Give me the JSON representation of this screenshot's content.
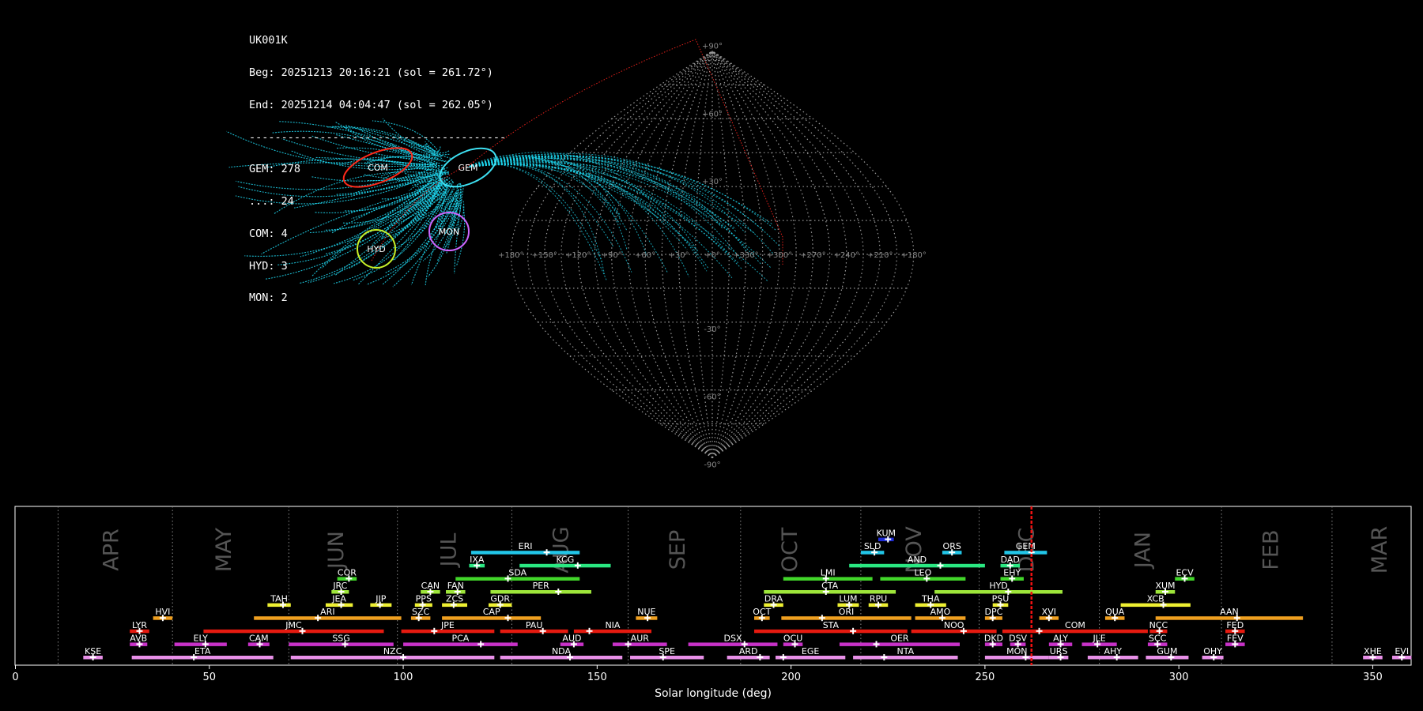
{
  "summary": {
    "station": "UK001K",
    "begin": "Beg: 20251213 20:16:21 (sol = 261.72°)",
    "end": "End: 20251214 04:04:47 (sol = 262.05°)",
    "separator": "----------------------------------------",
    "counts": [
      "GEM: 278",
      "...: 24",
      "COM: 4",
      "HYD: 3",
      "MON: 2"
    ]
  },
  "sky_map": {
    "projection": "sinusoidal",
    "lon_labels": [
      "+180°",
      "+150°",
      "+120°",
      "+90°",
      "+60°",
      "+30°",
      "+0°",
      "+330°",
      "+300°",
      "+270°",
      "+240°",
      "+210°",
      "+180°"
    ],
    "lat_labels": [
      "+90°",
      "+60°",
      "+30°",
      "-30°",
      "-60°",
      "-90°"
    ],
    "radiants": [
      {
        "name": "COM",
        "color": "#ff2a1a",
        "lon": 151,
        "lat": 33
      },
      {
        "name": "GEM",
        "color": "#3ee0f2",
        "lon": 112,
        "lat": 33
      },
      {
        "name": "MON",
        "color": "#cc66ff",
        "lon": 100,
        "lat": 8
      },
      {
        "name": "HYD",
        "color": "#c8f028",
        "lon": 128,
        "lat": 2
      }
    ]
  },
  "chart_data": {
    "type": "timeline",
    "xlabel": "Solar longitude (deg)",
    "xlim": [
      0,
      360
    ],
    "xticks": [
      0,
      50,
      100,
      150,
      200,
      250,
      300,
      350
    ],
    "current_sol": 262.0,
    "months": [
      {
        "label": "APR",
        "center": 25
      },
      {
        "label": "MAY",
        "center": 54
      },
      {
        "label": "JUN",
        "center": 83
      },
      {
        "label": "JUL",
        "center": 112
      },
      {
        "label": "AUG",
        "center": 141
      },
      {
        "label": "SEP",
        "center": 171
      },
      {
        "label": "OCT",
        "center": 200
      },
      {
        "label": "NOV",
        "center": 232
      },
      {
        "label": "DEC",
        "center": 261
      },
      {
        "label": "JAN",
        "center": 291
      },
      {
        "label": "FEB",
        "center": 324
      },
      {
        "label": "MAR",
        "center": 352
      }
    ],
    "month_boundaries": [
      11,
      40.5,
      70.5,
      98.5,
      128,
      158,
      187,
      218,
      248.5,
      279.5,
      311,
      339.5
    ],
    "showers": [
      {
        "code": "KUM",
        "row": 9,
        "start": 222.5,
        "end": 226.5,
        "peak": 225,
        "color": "#1d2bd6"
      },
      {
        "code": "ERI",
        "row": 8,
        "start": 117.5,
        "end": 145.5,
        "peak": 137,
        "color": "#22c6e8"
      },
      {
        "code": "SLD",
        "row": 8,
        "start": 218,
        "end": 224,
        "peak": 221.5,
        "color": "#22c6e8"
      },
      {
        "code": "ORS",
        "row": 8,
        "start": 239,
        "end": 244,
        "peak": 241.5,
        "color": "#22c6e8"
      },
      {
        "code": "GEM",
        "row": 8,
        "start": 255,
        "end": 266,
        "peak": 262,
        "color": "#22c6e8"
      },
      {
        "code": "IXA",
        "row": 7,
        "start": 117,
        "end": 121,
        "peak": 119,
        "color": "#2ae882"
      },
      {
        "code": "KCG",
        "row": 7,
        "start": 130,
        "end": 153.5,
        "peak": 145,
        "color": "#2ae882"
      },
      {
        "code": "AND",
        "row": 7,
        "start": 215,
        "end": 250,
        "peak": 238.5,
        "color": "#2ae882"
      },
      {
        "code": "DAD",
        "row": 7,
        "start": 254,
        "end": 259,
        "peak": 256.5,
        "color": "#2ae882"
      },
      {
        "code": "COR",
        "row": 6,
        "start": 83,
        "end": 88,
        "peak": 86,
        "color": "#42d62a"
      },
      {
        "code": "SDA",
        "row": 6,
        "start": 113.5,
        "end": 145.5,
        "peak": 127,
        "color": "#42d62a"
      },
      {
        "code": "LMI",
        "row": 6,
        "start": 198,
        "end": 221,
        "peak": 209,
        "color": "#42d62a"
      },
      {
        "code": "LEO",
        "row": 6,
        "start": 223,
        "end": 245,
        "peak": 235,
        "color": "#42d62a"
      },
      {
        "code": "EHY",
        "row": 6,
        "start": 254,
        "end": 260,
        "peak": 257,
        "color": "#42d62a"
      },
      {
        "code": "ECV",
        "row": 6,
        "start": 299,
        "end": 304,
        "peak": 301.5,
        "color": "#42d62a"
      },
      {
        "code": "JRC",
        "row": 5,
        "start": 81.5,
        "end": 86,
        "peak": 84,
        "color": "#9ee63a"
      },
      {
        "code": "CAN",
        "row": 5,
        "start": 104.5,
        "end": 109.5,
        "peak": 107,
        "color": "#9ee63a"
      },
      {
        "code": "FAN",
        "row": 5,
        "start": 111,
        "end": 116,
        "peak": 114,
        "color": "#9ee63a"
      },
      {
        "code": "PER",
        "row": 5,
        "start": 122.5,
        "end": 148.5,
        "peak": 140,
        "color": "#9ee63a"
      },
      {
        "code": "CTA",
        "row": 5,
        "start": 193,
        "end": 227,
        "peak": 209,
        "color": "#9ee63a"
      },
      {
        "code": "HYD",
        "row": 5,
        "start": 237,
        "end": 270,
        "peak": 256,
        "color": "#9ee63a"
      },
      {
        "code": "XUM",
        "row": 5,
        "start": 294,
        "end": 299,
        "peak": 296.5,
        "color": "#9ee63a"
      },
      {
        "code": "TAH",
        "row": 4,
        "start": 65,
        "end": 71,
        "peak": 69,
        "color": "#eef032"
      },
      {
        "code": "JEA",
        "row": 4,
        "start": 80,
        "end": 87,
        "peak": 84,
        "color": "#eef032"
      },
      {
        "code": "JIP",
        "row": 4,
        "start": 91.5,
        "end": 97,
        "peak": 94,
        "color": "#eef032"
      },
      {
        "code": "PPS",
        "row": 4,
        "start": 103,
        "end": 107.5,
        "peak": 105,
        "color": "#eef032"
      },
      {
        "code": "ZCS",
        "row": 4,
        "start": 110,
        "end": 116.5,
        "peak": 113,
        "color": "#eef032"
      },
      {
        "code": "GDR",
        "row": 4,
        "start": 122,
        "end": 128,
        "peak": 125,
        "color": "#eef032"
      },
      {
        "code": "DRA",
        "row": 4,
        "start": 193,
        "end": 198,
        "peak": 195.5,
        "color": "#eef032"
      },
      {
        "code": "LUM",
        "row": 4,
        "start": 212,
        "end": 217.5,
        "peak": 215,
        "color": "#eef032"
      },
      {
        "code": "RPU",
        "row": 4,
        "start": 220,
        "end": 225,
        "peak": 222.5,
        "color": "#eef032"
      },
      {
        "code": "THA",
        "row": 4,
        "start": 232,
        "end": 240,
        "peak": 236,
        "color": "#eef032"
      },
      {
        "code": "PSU",
        "row": 4,
        "start": 252,
        "end": 256,
        "peak": 254,
        "color": "#eef032"
      },
      {
        "code": "XCB",
        "row": 4,
        "start": 285,
        "end": 303,
        "peak": 296,
        "color": "#eef032"
      },
      {
        "code": "HVI",
        "row": 3,
        "start": 35.5,
        "end": 40.5,
        "peak": 38,
        "color": "#f0a020"
      },
      {
        "code": "ARI",
        "row": 3,
        "start": 61.5,
        "end": 99.5,
        "peak": 78,
        "color": "#f0a020"
      },
      {
        "code": "SZC",
        "row": 3,
        "start": 102,
        "end": 107,
        "peak": 104,
        "color": "#f0a020"
      },
      {
        "code": "CAP",
        "row": 3,
        "start": 110,
        "end": 135.5,
        "peak": 127,
        "color": "#f0a020"
      },
      {
        "code": "NUE",
        "row": 3,
        "start": 160,
        "end": 165.5,
        "peak": 163,
        "color": "#f0a020"
      },
      {
        "code": "OCT",
        "row": 3,
        "start": 190.5,
        "end": 194.5,
        "peak": 192.5,
        "color": "#f0a020"
      },
      {
        "code": "ORI",
        "row": 3,
        "start": 197.5,
        "end": 231,
        "peak": 208,
        "color": "#f0a020"
      },
      {
        "code": "AMO",
        "row": 3,
        "start": 232,
        "end": 245,
        "peak": 239,
        "color": "#f0a020"
      },
      {
        "code": "DPC",
        "row": 3,
        "start": 250,
        "end": 254.5,
        "peak": 252,
        "color": "#f0a020"
      },
      {
        "code": "XVI",
        "row": 3,
        "start": 264,
        "end": 269,
        "peak": 266.5,
        "color": "#f0a020"
      },
      {
        "code": "QUA",
        "row": 3,
        "start": 281,
        "end": 286,
        "peak": 283.5,
        "color": "#f0a020"
      },
      {
        "code": "AAN",
        "row": 3,
        "start": 294,
        "end": 332,
        "peak": 315,
        "color": "#f0a020"
      },
      {
        "code": "LYR",
        "row": 2,
        "start": 29.5,
        "end": 34.5,
        "peak": 32,
        "color": "#e61a10"
      },
      {
        "code": "JMC",
        "row": 2,
        "start": 48.5,
        "end": 95,
        "peak": 74,
        "color": "#e61a10"
      },
      {
        "code": "JPE",
        "row": 2,
        "start": 99.5,
        "end": 123.5,
        "peak": 108,
        "color": "#e61a10"
      },
      {
        "code": "PAU",
        "row": 2,
        "start": 125,
        "end": 142.5,
        "peak": 136,
        "color": "#e61a10"
      },
      {
        "code": "NIA",
        "row": 2,
        "start": 144,
        "end": 164,
        "peak": 148,
        "color": "#e61a10"
      },
      {
        "code": "STA",
        "row": 2,
        "start": 190.5,
        "end": 230,
        "peak": 216,
        "color": "#e61a10"
      },
      {
        "code": "NOO",
        "row": 2,
        "start": 231,
        "end": 253,
        "peak": 244.5,
        "color": "#e61a10"
      },
      {
        "code": "COM",
        "row": 2,
        "start": 254.5,
        "end": 292,
        "peak": 264,
        "color": "#e61a10"
      },
      {
        "code": "NCC",
        "row": 2,
        "start": 292.5,
        "end": 297,
        "peak": 295,
        "color": "#e61a10"
      },
      {
        "code": "FED",
        "row": 2,
        "start": 312,
        "end": 317,
        "peak": 314.5,
        "color": "#e61a10"
      },
      {
        "code": "AVB",
        "row": 1,
        "start": 29.5,
        "end": 34,
        "peak": 32,
        "color": "#c832c8"
      },
      {
        "code": "ELY",
        "row": 1,
        "start": 41,
        "end": 54.5,
        "peak": 49,
        "color": "#c832c8"
      },
      {
        "code": "CAM",
        "row": 1,
        "start": 60,
        "end": 65.5,
        "peak": 63,
        "color": "#c832c8"
      },
      {
        "code": "SSG",
        "row": 1,
        "start": 70.5,
        "end": 97.5,
        "peak": 85,
        "color": "#c832c8"
      },
      {
        "code": "PCA",
        "row": 1,
        "start": 100,
        "end": 129.5,
        "peak": 120,
        "color": "#c832c8"
      },
      {
        "code": "AUD",
        "row": 1,
        "start": 140.5,
        "end": 146.5,
        "peak": 144,
        "color": "#c832c8"
      },
      {
        "code": "AUR",
        "row": 1,
        "start": 154,
        "end": 168,
        "peak": 158,
        "color": "#c832c8"
      },
      {
        "code": "DSX",
        "row": 1,
        "start": 173.5,
        "end": 196.5,
        "peak": 188,
        "color": "#c832c8"
      },
      {
        "code": "OCU",
        "row": 1,
        "start": 198,
        "end": 203,
        "peak": 201,
        "color": "#c832c8"
      },
      {
        "code": "OER",
        "row": 1,
        "start": 212.5,
        "end": 243.5,
        "peak": 222,
        "color": "#c832c8"
      },
      {
        "code": "DKD",
        "row": 1,
        "start": 250,
        "end": 254.5,
        "peak": 252,
        "color": "#c832c8"
      },
      {
        "code": "DSV",
        "row": 1,
        "start": 256.5,
        "end": 260.5,
        "peak": 258.5,
        "color": "#c832c8"
      },
      {
        "code": "ALY",
        "row": 1,
        "start": 266.5,
        "end": 272.5,
        "peak": 269.5,
        "color": "#c832c8"
      },
      {
        "code": "JLE",
        "row": 1,
        "start": 275,
        "end": 284,
        "peak": 279,
        "color": "#c832c8"
      },
      {
        "code": "SCC",
        "row": 1,
        "start": 292,
        "end": 297,
        "peak": 294.5,
        "color": "#c832c8"
      },
      {
        "code": "FEV",
        "row": 1,
        "start": 312,
        "end": 317,
        "peak": 314.5,
        "color": "#c832c8"
      },
      {
        "code": "KSE",
        "row": 0,
        "start": 17.5,
        "end": 22.5,
        "peak": 20,
        "color": "#e890e8"
      },
      {
        "code": "ETA",
        "row": 0,
        "start": 30,
        "end": 66.5,
        "peak": 46,
        "color": "#e890e8"
      },
      {
        "code": "NZC",
        "row": 0,
        "start": 71,
        "end": 123.5,
        "peak": 100,
        "color": "#e890e8"
      },
      {
        "code": "NDA",
        "row": 0,
        "start": 125,
        "end": 156.5,
        "peak": 143,
        "color": "#e890e8"
      },
      {
        "code": "SPE",
        "row": 0,
        "start": 158.5,
        "end": 177.5,
        "peak": 167,
        "color": "#e890e8"
      },
      {
        "code": "ARD",
        "row": 0,
        "start": 183.5,
        "end": 194.5,
        "peak": 192,
        "color": "#e890e8"
      },
      {
        "code": "EGE",
        "row": 0,
        "start": 196,
        "end": 214,
        "peak": 198,
        "color": "#e890e8"
      },
      {
        "code": "NTA",
        "row": 0,
        "start": 216,
        "end": 243,
        "peak": 224,
        "color": "#e890e8"
      },
      {
        "code": "MON",
        "row": 0,
        "start": 250,
        "end": 266.5,
        "peak": 260.5,
        "color": "#e890e8"
      },
      {
        "code": "URS",
        "row": 0,
        "start": 266.5,
        "end": 271.5,
        "peak": 269.5,
        "color": "#e890e8"
      },
      {
        "code": "AHY",
        "row": 0,
        "start": 276.5,
        "end": 289.5,
        "peak": 284,
        "color": "#e890e8"
      },
      {
        "code": "GUM",
        "row": 0,
        "start": 291.5,
        "end": 302.5,
        "peak": 298,
        "color": "#e890e8"
      },
      {
        "code": "OHY",
        "row": 0,
        "start": 306,
        "end": 311.5,
        "peak": 309,
        "color": "#e890e8"
      },
      {
        "code": "XHE",
        "row": 0,
        "start": 347.5,
        "end": 352.5,
        "peak": 350,
        "color": "#e890e8"
      },
      {
        "code": "EVI",
        "row": 0,
        "start": 355,
        "end": 360,
        "peak": 357.5,
        "color": "#e890e8"
      }
    ]
  }
}
